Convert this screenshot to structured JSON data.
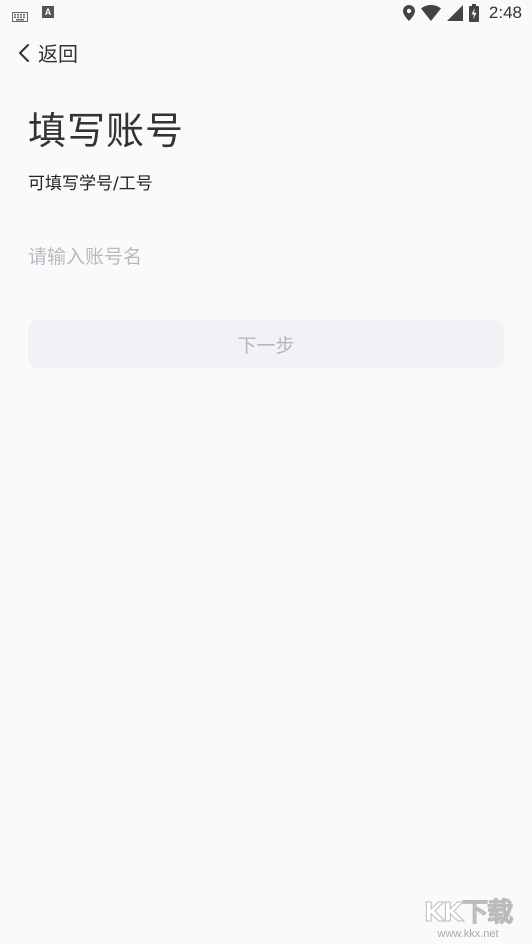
{
  "status_bar": {
    "time": "2:48",
    "icons": [
      "keyboard-icon",
      "a-icon",
      "location-icon",
      "wifi-icon",
      "signal-icon",
      "battery-charging-icon"
    ]
  },
  "nav": {
    "back_label": "返回"
  },
  "title": "填写账号",
  "subtitle": "可填写学号/工号",
  "account_input": {
    "value": "",
    "placeholder": "请输入账号名"
  },
  "next_button": {
    "label": "下一步"
  },
  "watermark": {
    "logo": "KK下载",
    "url": "www.kkx.net"
  },
  "colors": {
    "background": "#fafafa",
    "button_bg": "#f1f2f6",
    "button_text": "#b3b6bd",
    "placeholder": "#b6bac3"
  }
}
